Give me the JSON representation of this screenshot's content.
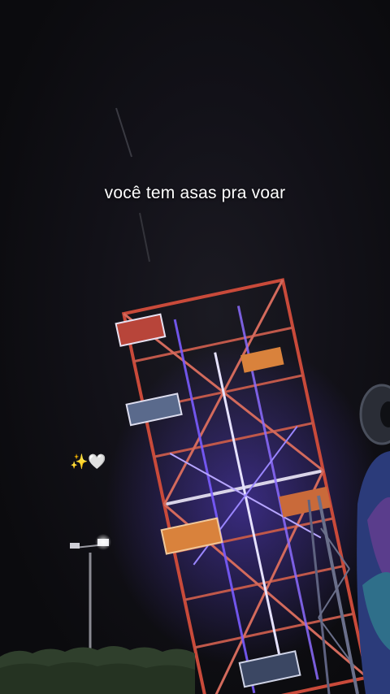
{
  "caption": {
    "text": "você tem asas pra voar"
  },
  "sticker": {
    "sparkles": "✨",
    "heart": "🤍"
  },
  "colors": {
    "sky": "#111016",
    "frame": "#c94a3a",
    "neon_purple": "#7a5cff",
    "neon_white": "#e6e2ff",
    "gondola_red": "#b8453a",
    "gondola_blue": "#5a6a8c",
    "gondola_orange": "#d9823c",
    "foliage": "#2f3f2c"
  },
  "icons": {
    "sparkle": "sparkles-icon",
    "heart": "white-heart-icon",
    "street_light": "street-light-icon",
    "ferris_wheel": "ferris-wheel-icon"
  }
}
